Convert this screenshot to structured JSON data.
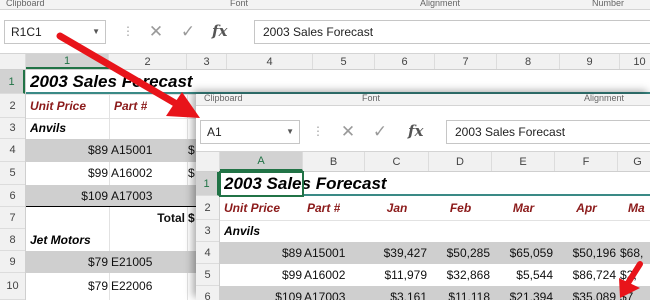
{
  "back": {
    "ribbon": {
      "groups": [
        "Clipboard",
        "Font",
        "Alignment",
        "Number"
      ]
    },
    "name_box": "R1C1",
    "formula": "2003 Sales Forecast",
    "columns": [
      "1",
      "2",
      "3",
      "4",
      "5",
      "6",
      "7",
      "8",
      "9",
      "10"
    ],
    "rows": [
      "1",
      "2",
      "3",
      "4",
      "5",
      "6",
      "7",
      "8",
      "9",
      "10"
    ],
    "cells": {
      "r1": "2003 Sales Forecast",
      "r2_a": "Unit Price",
      "r2_b": "Part #",
      "r3": "Anvils",
      "r4_a": "$89",
      "r4_b": "A15001",
      "r4_c": "$",
      "r5_a": "$99",
      "r5_b": "A16002",
      "r5_c": "$",
      "r6_a": "$109",
      "r6_b": "A17003",
      "r7_b": "Total",
      "r7_c": "$",
      "r8": "Jet Motors",
      "r9_a": "$79",
      "r9_b": "E21005",
      "r10_a": "$79",
      "r10_b": "E22006"
    }
  },
  "front": {
    "ribbon": {
      "groups": [
        "Clipboard",
        "Font",
        "Alignment"
      ]
    },
    "name_box": "A1",
    "formula": "2003 Sales Forecast",
    "columns": [
      "A",
      "B",
      "C",
      "D",
      "E",
      "F",
      "G"
    ],
    "rows": [
      "1",
      "2",
      "3",
      "4",
      "5",
      "6"
    ],
    "title": "2003 Sales Forecast",
    "headers": [
      "Unit Price",
      "Part #",
      "Jan",
      "Feb",
      "Mar",
      "Apr",
      "Ma"
    ],
    "group": "Anvils",
    "data": [
      [
        "$89",
        "A15001",
        "$39,427",
        "$50,285",
        "$65,059",
        "$50,196",
        "$68,"
      ],
      [
        "$99",
        "A16002",
        "$11,979",
        "$32,868",
        "$5,544",
        "$86,724",
        "$2,"
      ],
      [
        "$109",
        "A17003",
        "$3,161",
        "$11,118",
        "$21,394",
        "$35,089",
        "$7"
      ]
    ]
  },
  "icons": {
    "cancel": "✕",
    "enter": "✓",
    "function": "fx"
  },
  "colors": {
    "accent": "#217346",
    "header_text": "#8b1a1a",
    "arrow": "#e8141a",
    "shaded_row": "#cfcfcf"
  }
}
